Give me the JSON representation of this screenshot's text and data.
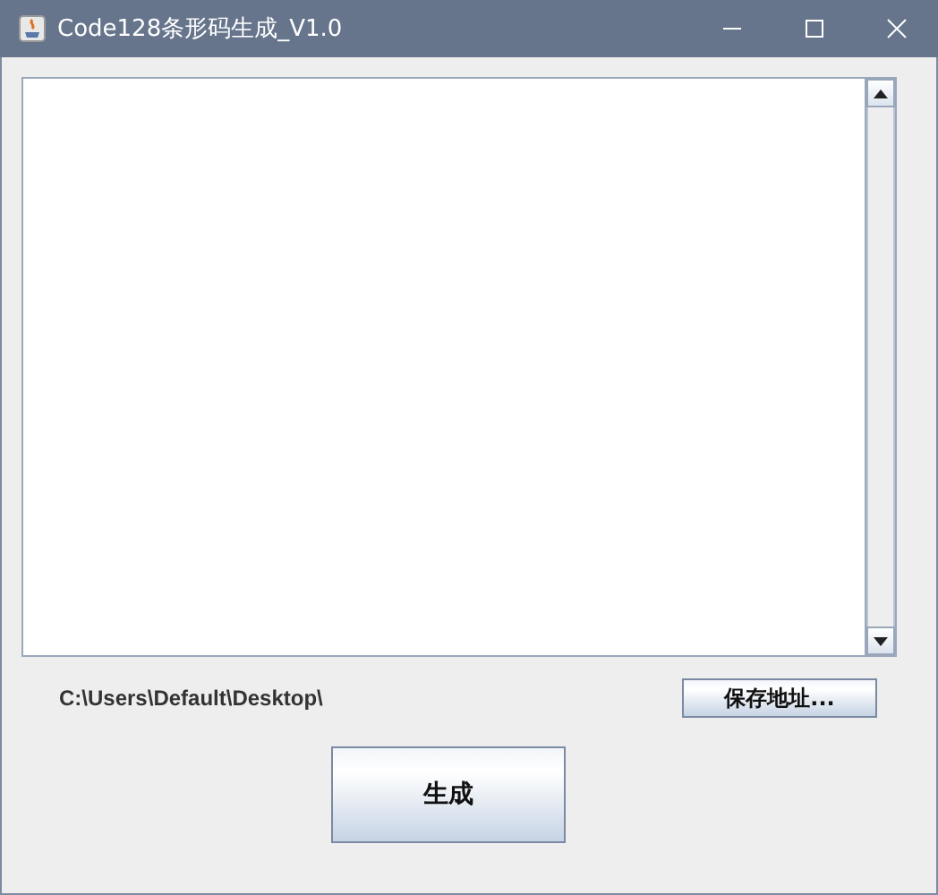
{
  "window": {
    "title": "Code128条形码生成_V1.0"
  },
  "save_path": "C:\\Users\\Default\\Desktop\\",
  "buttons": {
    "save_location": "保存地址...",
    "generate": "生成"
  }
}
